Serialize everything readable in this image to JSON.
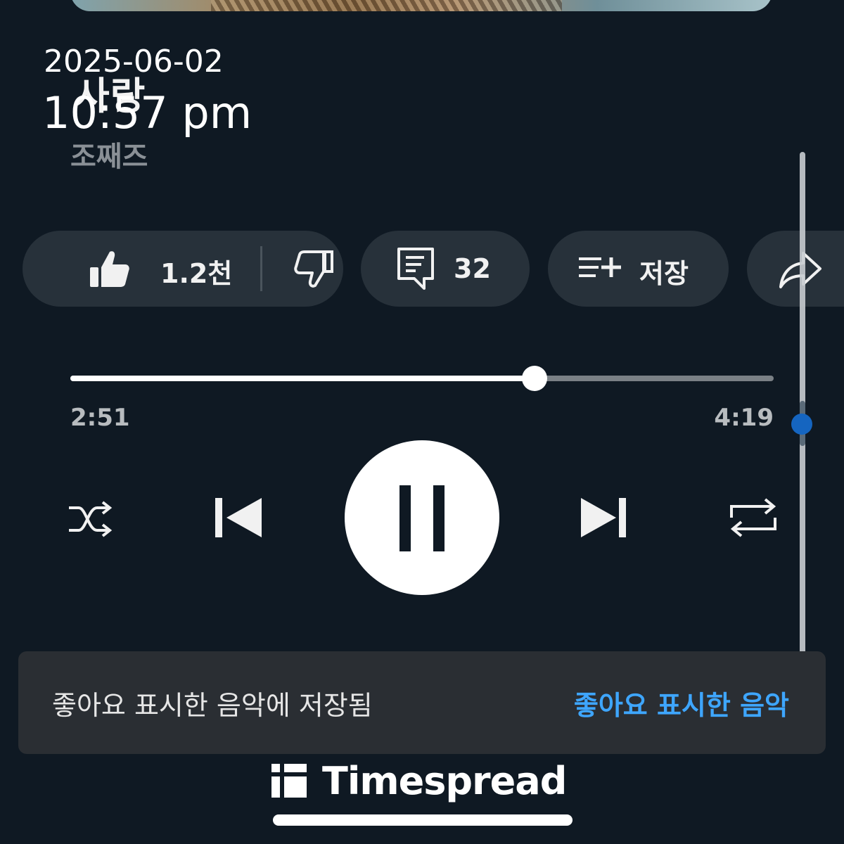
{
  "overlay": {
    "date": "2025-06-02",
    "time": "10:57 pm"
  },
  "song": {
    "title": "사랑",
    "artist": "조째즈"
  },
  "actions": {
    "like_count": "1.2천",
    "comment_count": "32",
    "save_label": "저장"
  },
  "player": {
    "elapsed": "2:51",
    "total": "4:19",
    "progress": 0.66
  },
  "snackbar": {
    "message": "좋아요 표시한 음악에 저장됨",
    "action": "좋아요 표시한 음악"
  },
  "watermark": {
    "text": "Timespread"
  },
  "colors": {
    "background": "#0f1923",
    "chip": "#27313a",
    "accent_link": "#3ea6ff",
    "scroll_dot": "#1565c0"
  },
  "icons": [
    "thumbs-up-icon",
    "thumbs-down-icon",
    "comment-icon",
    "playlist-add-icon",
    "share-icon",
    "shuffle-icon",
    "skip-previous-icon",
    "pause-icon",
    "skip-next-icon",
    "repeat-icon"
  ]
}
